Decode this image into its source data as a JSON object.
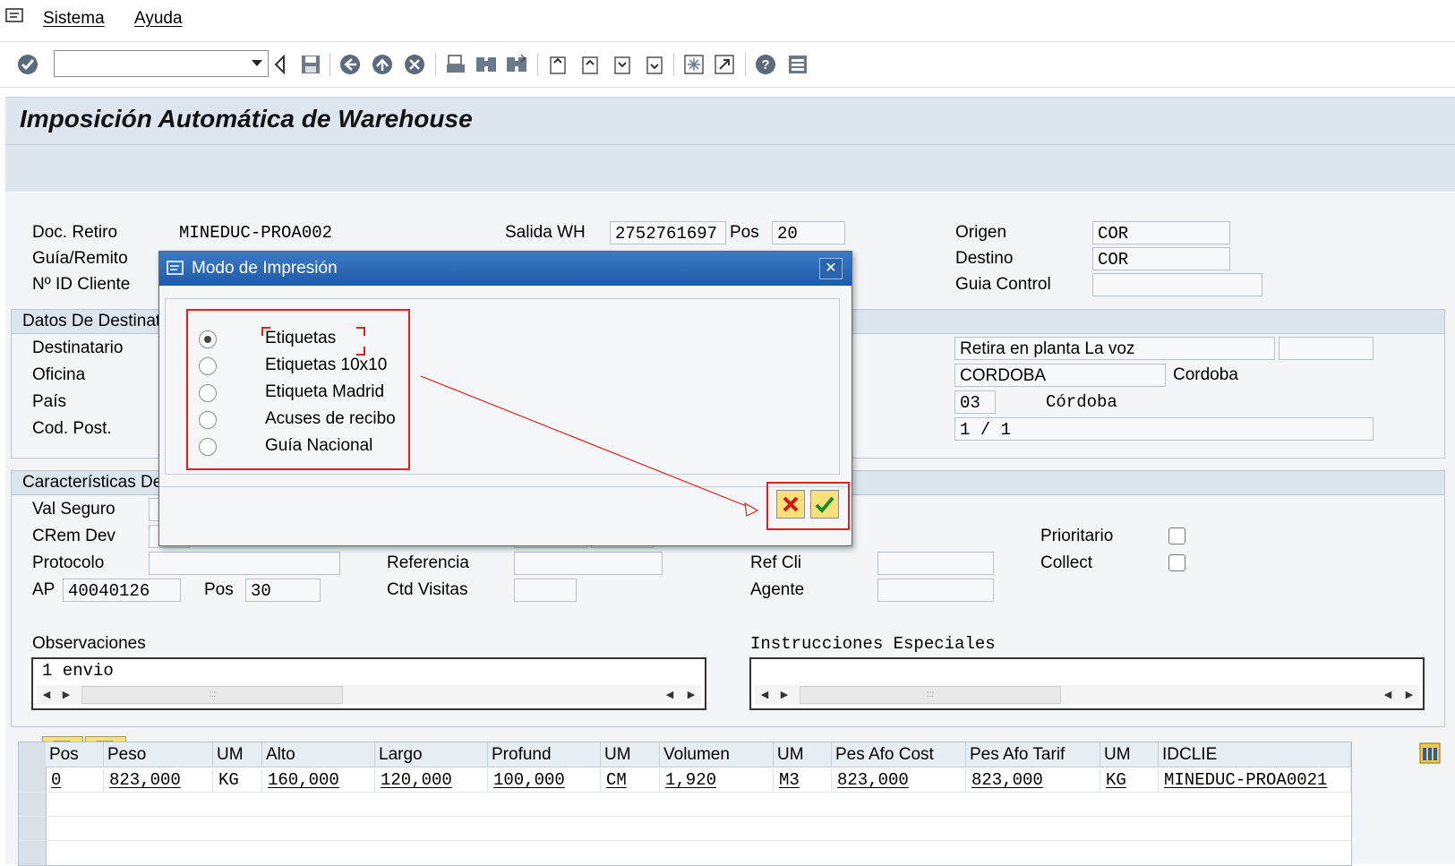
{
  "menu": {
    "items": [
      "Sistema",
      "Ayuda"
    ]
  },
  "toolbar": {
    "command_value": ""
  },
  "page_title": "Imposición Automática de Warehouse",
  "header": {
    "doc_retiro_label": "Doc. Retiro",
    "doc_retiro_value": "MINEDUC-PROA002",
    "guia_remito_label": "Guía/Remito",
    "id_cliente_label": "Nº ID Cliente",
    "salida_wh_label": "Salida WH",
    "salida_wh_value": "2752761697",
    "pos_label": "Pos",
    "pos_value": "20",
    "origen_label": "Origen",
    "origen_value": "COR",
    "destino_label": "Destino",
    "destino_value": "COR",
    "guia_control_label": "Guia Control",
    "guia_control_value": ""
  },
  "destino_group": {
    "title": "Datos De Destinatario",
    "destinatario_label": "Destinatario",
    "oficina_label": "Oficina",
    "pais_label": "País",
    "cod_post_label": "Cod. Post.",
    "retira_value": "Retira en planta La voz",
    "ciudad_value": "CORDOBA",
    "ciudad_text": "Cordoba",
    "region_code": "03",
    "region_name": "Córdoba",
    "bultos_value": "1 / 1"
  },
  "caract_group": {
    "title": "Características Del Envío",
    "val_seguro_label": "Val Seguro",
    "crem_dev_label": "CRem Dev",
    "protocolo_label": "Protocolo",
    "ap_label": "AP",
    "ap_value": "40040126",
    "pos_label": "Pos",
    "pos_value": "30",
    "referencia_label": "Referencia",
    "ctd_visitas_label": "Ctd Visitas",
    "ref_cli_label": "Ref Cli",
    "agente_label": "Agente",
    "prioritario_label": "Prioritario",
    "collect_label": "Collect"
  },
  "observaciones": {
    "label": "Observaciones",
    "text": "1 envio"
  },
  "instrucciones": {
    "label": "Instrucciones Especiales",
    "text": ""
  },
  "table": {
    "columns": [
      "Pos",
      "Peso",
      "UM",
      "Alto",
      "Largo",
      "Profund",
      "UM",
      "Volumen",
      "UM",
      "Pes Afo Cost",
      "Pes Afo Tarif",
      "UM",
      "IDCLIE"
    ],
    "rows": [
      [
        "0",
        "823,000",
        "KG",
        "160,000",
        "120,000",
        "100,000",
        "CM",
        "1,920",
        "M3",
        "823,000",
        "823,000",
        "KG",
        "MINEDUC-PROA0021"
      ]
    ]
  },
  "dialog": {
    "title": "Modo de Impresión",
    "options": [
      "Etiquetas",
      "Etiquetas 10x10",
      "Etiqueta Madrid",
      "Acuses de recibo",
      "Guía Nacional"
    ],
    "selected_index": 0
  },
  "colors": {
    "title_blue": "#1f5aa8",
    "highlight_red": "#e02020",
    "button_yellow": "#f8e07a"
  }
}
